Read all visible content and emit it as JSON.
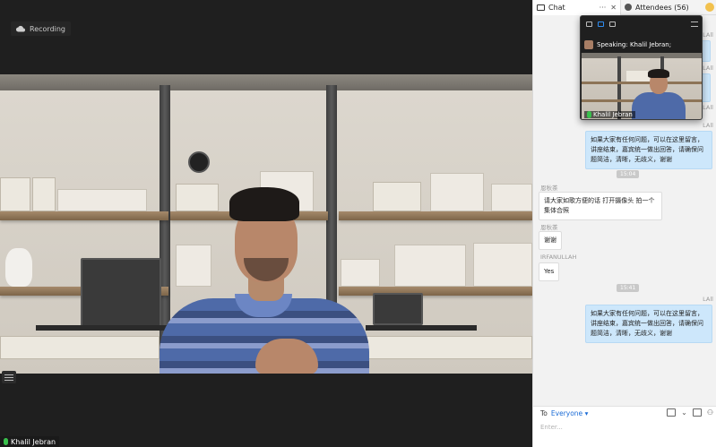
{
  "recording": {
    "label": "Recording",
    "icon": "cloud-icon"
  },
  "video": {
    "participant_name": "Khalil Jebran"
  },
  "panel": {
    "tabs": [
      {
        "label": "Chat",
        "icon": "chat-icon"
      },
      {
        "label": "Attendees (56)",
        "icon": "person-icon"
      }
    ],
    "tab_controls": {
      "more": "···",
      "close": "✕"
    }
  },
  "mini_window": {
    "speaking_label": "Speaking: Khalil Jebran;",
    "name": "Khalil Jebran"
  },
  "messages": [
    {
      "sender": "LAll"
    },
    {
      "sender": "LAll"
    },
    {
      "sender": "LAll"
    },
    {
      "sender": "LAll",
      "text": "如果大家有任何问题，可以在这里留言，讲座结束，嘉宾统一做出回答，请确保问题简洁，清晰，无歧义，谢谢"
    },
    {
      "time": "15:04"
    },
    {
      "sender": "恩秋茶",
      "text": "请大家如歌方便的话 打开摄像头 拍一个集体合照"
    },
    {
      "sender": "恩秋茶",
      "text": "谢谢"
    },
    {
      "sender": "IRFANULLAH",
      "text": "Yes"
    },
    {
      "time": "15:41"
    },
    {
      "sender": "LAll",
      "text": "如果大家有任何问题，可以在这里留言，讲座结束，嘉宾统一做出回答，请确保问题简洁，清晰，无歧义，谢谢"
    }
  ],
  "composer": {
    "to_label": "To",
    "to_target": "Everyone",
    "placeholder": "Enter..."
  },
  "colors": {
    "accent": "#2e8cf0",
    "my_bubble": "#cde7fb",
    "mic_green": "#39c04c",
    "dark_bg": "#1f1f1f"
  }
}
